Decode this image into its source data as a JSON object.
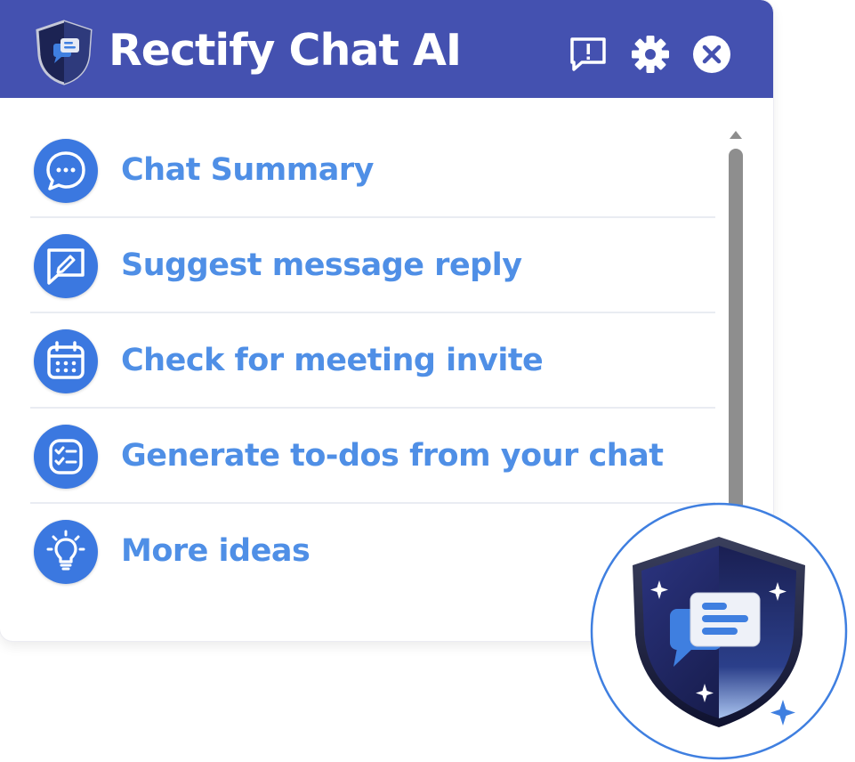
{
  "app": {
    "title": "Rectify Chat AI",
    "colors": {
      "header": "#4451b0",
      "accent": "#3b78e0",
      "label": "#4f8fe6"
    }
  },
  "header": {
    "buttons": [
      {
        "name": "feedback",
        "icon": "feedback-icon"
      },
      {
        "name": "settings",
        "icon": "gear-icon"
      },
      {
        "name": "close",
        "icon": "close-icon"
      }
    ]
  },
  "menu": {
    "items": [
      {
        "label": "Chat Summary",
        "icon": "chat-bubble-icon"
      },
      {
        "label": "Suggest message reply",
        "icon": "edit-message-icon"
      },
      {
        "label": "Check for meeting invite",
        "icon": "calendar-icon"
      },
      {
        "label": "Generate to-dos from your chat",
        "icon": "checklist-icon"
      },
      {
        "label": "More ideas",
        "icon": "lightbulb-icon"
      }
    ]
  },
  "badge": {
    "icon": "rectify-shield-chat-icon"
  }
}
